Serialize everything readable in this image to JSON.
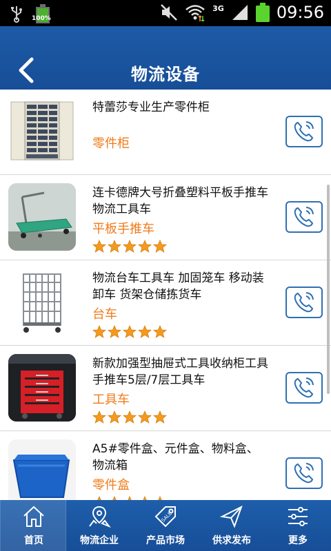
{
  "status_bar": {
    "battery_left_label": "100%",
    "network": "3G",
    "time": "09:56"
  },
  "header": {
    "title": "物流设备"
  },
  "products": [
    {
      "title": "特蕾莎专业生产零件柜",
      "category": "零件柜",
      "rating": 0
    },
    {
      "title": "连卡德牌大号折叠塑料平板手推车 物流工具车",
      "category": "平板手推车",
      "rating": 5
    },
    {
      "title": "物流台车工具车 加固笼车 移动装卸车 货架仓储拣货车",
      "category": "台车",
      "rating": 5
    },
    {
      "title": "新款加强型抽屉式工具收纳柜工具手推车5层/7层工具车",
      "category": "工具车",
      "rating": 5
    },
    {
      "title": "A5#零件盒、元件盒、物料盒、物流箱",
      "category": "零件盒",
      "rating": 5
    }
  ],
  "bottom_nav": [
    {
      "label": "首页",
      "icon": "home-icon"
    },
    {
      "label": "物流企业",
      "icon": "map-pin-icon"
    },
    {
      "label": "产品市场",
      "icon": "tag-icon"
    },
    {
      "label": "供求发布",
      "icon": "send-icon"
    },
    {
      "label": "更多",
      "icon": "sliders-icon"
    }
  ],
  "colors": {
    "header_blue": "#1d5aa7",
    "category_orange": "#f07b1a",
    "star_orange": "#f39a1f",
    "call_border": "#2d6fb4"
  }
}
